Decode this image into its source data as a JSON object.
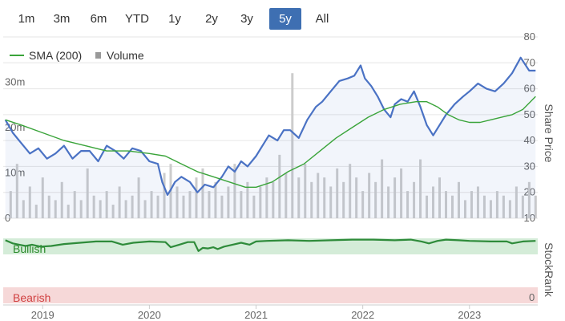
{
  "range_selector": {
    "buttons": [
      "1m",
      "3m",
      "6m",
      "YTD",
      "1y",
      "2y",
      "3y",
      "5y",
      "All"
    ],
    "selected": "5y"
  },
  "legend": {
    "sma_label": "SMA (200)",
    "volume_label": "Volume"
  },
  "colors": {
    "price": "#4a72c4",
    "sma": "#3aa43a",
    "volume": "#cccccc",
    "stockrank": "#2e8b3a",
    "bullish_band": "#d4ecd8",
    "bearish_band": "#f6d8d8",
    "bullish_text": "#2a8a2a",
    "bearish_text": "#d04040",
    "active_button": "#3e6fb2"
  },
  "price_axis": {
    "title": "Share Price",
    "ticks": [
      "80",
      "70",
      "60",
      "50",
      "40",
      "30",
      "20",
      "10"
    ]
  },
  "volume_axis": {
    "ticks": [
      "30m",
      "20m",
      "10m",
      "0"
    ]
  },
  "stockrank_axis": {
    "title": "StockRank",
    "min_label": "0"
  },
  "bands": {
    "bullish": "Bullish",
    "bearish": "Bearish"
  },
  "x_axis": {
    "ticks": [
      "2019",
      "2020",
      "2021",
      "2022",
      "2023"
    ]
  },
  "chart_data": {
    "type": "line",
    "x_unit": "year",
    "price_ylim": [
      10,
      80
    ],
    "volume_ylim": [
      0,
      40
    ],
    "stockrank_ylim": [
      0,
      100
    ],
    "series": [
      {
        "name": "Share Price",
        "x": [
          2018.65,
          2018.72,
          2018.8,
          2018.88,
          2018.96,
          2019.04,
          2019.12,
          2019.2,
          2019.28,
          2019.36,
          2019.44,
          2019.52,
          2019.6,
          2019.68,
          2019.76,
          2019.84,
          2019.92,
          2020.0,
          2020.08,
          2020.12,
          2020.17,
          2020.2,
          2020.24,
          2020.3,
          2020.38,
          2020.45,
          2020.52,
          2020.6,
          2020.68,
          2020.74,
          2020.8,
          2020.86,
          2020.92,
          2021.0,
          2021.06,
          2021.12,
          2021.2,
          2021.26,
          2021.32,
          2021.4,
          2021.48,
          2021.56,
          2021.62,
          2021.7,
          2021.78,
          2021.86,
          2021.92,
          2021.98,
          2022.02,
          2022.08,
          2022.14,
          2022.2,
          2022.26,
          2022.3,
          2022.36,
          2022.42,
          2022.48,
          2022.54,
          2022.6,
          2022.66,
          2022.72,
          2022.78,
          2022.86,
          2022.94,
          2023.0,
          2023.08,
          2023.16,
          2023.24,
          2023.32,
          2023.4,
          2023.48,
          2023.56,
          2023.62
        ],
        "y": [
          48,
          43,
          39,
          35,
          37,
          33,
          35,
          38,
          33,
          36,
          36,
          32,
          38,
          36,
          33,
          37,
          36,
          32,
          31,
          24,
          19,
          21,
          24,
          26,
          24,
          20,
          23,
          22,
          26,
          30,
          28,
          32,
          30,
          34,
          38,
          42,
          40,
          44,
          44,
          41,
          48,
          53,
          55,
          59,
          63,
          64,
          65,
          69,
          64,
          61,
          57,
          52,
          49,
          54,
          56,
          55,
          59,
          53,
          46,
          42,
          46,
          50,
          54,
          57,
          59,
          62,
          60,
          59,
          62,
          66,
          72,
          67,
          67
        ]
      },
      {
        "name": "SMA (200)",
        "x": [
          2018.65,
          2018.8,
          2019.0,
          2019.2,
          2019.4,
          2019.6,
          2019.8,
          2020.0,
          2020.15,
          2020.3,
          2020.45,
          2020.6,
          2020.75,
          2020.9,
          2021.0,
          2021.15,
          2021.3,
          2021.45,
          2021.6,
          2021.75,
          2021.9,
          2022.05,
          2022.2,
          2022.35,
          2022.5,
          2022.6,
          2022.7,
          2022.8,
          2022.9,
          2023.0,
          2023.1,
          2023.2,
          2023.3,
          2023.4,
          2023.5,
          2023.62
        ],
        "y": [
          48,
          46,
          43,
          40,
          38,
          36,
          36,
          35,
          34,
          31,
          28,
          26,
          24,
          22,
          22,
          24,
          28,
          31,
          36,
          41,
          45,
          49,
          52,
          54,
          55,
          55,
          53,
          50,
          48,
          47,
          47,
          48,
          49,
          50,
          52,
          57
        ]
      },
      {
        "name": "StockRank",
        "x": [
          2018.65,
          2018.72,
          2018.78,
          2018.84,
          2018.9,
          2018.98,
          2019.08,
          2019.2,
          2019.35,
          2019.5,
          2019.65,
          2019.75,
          2019.85,
          2020.0,
          2020.15,
          2020.2,
          2020.28,
          2020.36,
          2020.42,
          2020.46,
          2020.5,
          2020.55,
          2020.6,
          2020.64,
          2020.7,
          2020.78,
          2020.86,
          2020.94,
          2021.0,
          2021.1,
          2021.3,
          2021.5,
          2021.7,
          2021.9,
          2022.1,
          2022.3,
          2022.45,
          2022.55,
          2022.62,
          2022.7,
          2022.78,
          2022.9,
          2023.0,
          2023.2,
          2023.35,
          2023.4,
          2023.5,
          2023.62
        ],
        "y": [
          97,
          92,
          90,
          88,
          90,
          87,
          88,
          91,
          93,
          95,
          95,
          90,
          93,
          95,
          94,
          86,
          90,
          94,
          94,
          80,
          85,
          84,
          86,
          83,
          87,
          90,
          93,
          90,
          95,
          96,
          97,
          96,
          97,
          98,
          98,
          97,
          98,
          95,
          92,
          96,
          98,
          97,
          96,
          95,
          95,
          92,
          95,
          96
        ]
      },
      {
        "name": "Volume",
        "x": [
          2018.7,
          2018.76,
          2018.82,
          2018.88,
          2018.94,
          2019.0,
          2019.06,
          2019.12,
          2019.18,
          2019.24,
          2019.3,
          2019.36,
          2019.42,
          2019.48,
          2019.54,
          2019.6,
          2019.66,
          2019.72,
          2019.78,
          2019.84,
          2019.9,
          2019.96,
          2020.02,
          2020.08,
          2020.14,
          2020.2,
          2020.26,
          2020.32,
          2020.38,
          2020.44,
          2020.5,
          2020.56,
          2020.62,
          2020.68,
          2020.74,
          2020.8,
          2020.86,
          2020.92,
          2020.98,
          2021.04,
          2021.1,
          2021.16,
          2021.22,
          2021.28,
          2021.34,
          2021.4,
          2021.46,
          2021.52,
          2021.58,
          2021.64,
          2021.7,
          2021.76,
          2021.82,
          2021.88,
          2021.94,
          2022.0,
          2022.06,
          2022.12,
          2022.18,
          2022.24,
          2022.3,
          2022.36,
          2022.42,
          2022.48,
          2022.54,
          2022.6,
          2022.66,
          2022.72,
          2022.78,
          2022.84,
          2022.9,
          2022.96,
          2023.02,
          2023.08,
          2023.14,
          2023.2,
          2023.26,
          2023.32,
          2023.38,
          2023.44,
          2023.5,
          2023.56,
          2023.62
        ],
        "y": [
          6,
          12,
          4,
          7,
          3,
          9,
          5,
          4,
          8,
          3,
          6,
          4,
          11,
          5,
          4,
          6,
          3,
          7,
          4,
          5,
          9,
          4,
          6,
          5,
          10,
          12,
          7,
          5,
          6,
          9,
          11,
          6,
          8,
          5,
          7,
          12,
          6,
          8,
          5,
          7,
          9,
          8,
          14,
          10,
          32,
          9,
          12,
          8,
          10,
          9,
          7,
          11,
          8,
          12,
          9,
          6,
          10,
          8,
          13,
          7,
          9,
          11,
          6,
          8,
          13,
          5,
          7,
          9,
          6,
          5,
          8,
          4,
          6,
          7,
          5,
          4,
          6,
          5,
          4,
          7,
          5,
          8,
          5
        ]
      }
    ]
  }
}
